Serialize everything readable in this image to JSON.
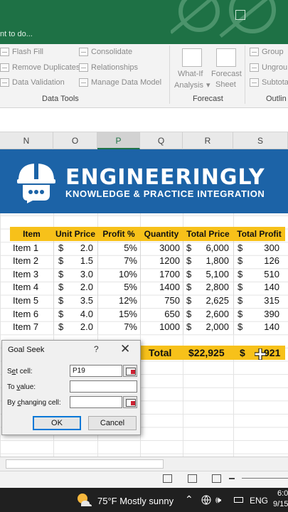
{
  "titlebar": {
    "tell_me": "nt to do..."
  },
  "ribbon": {
    "items": [
      "Flash Fill",
      "Remove Duplicates",
      "Data Validation",
      "Consolidate",
      "Relationships",
      "Manage Data Model",
      "What-If",
      "Analysis",
      "Forecast",
      "Sheet",
      "Group",
      "Ungrou",
      "Subtota"
    ],
    "groups": [
      "Data Tools",
      "Forecast",
      "Outlin"
    ]
  },
  "columns": [
    "N",
    "O",
    "P",
    "Q",
    "R",
    "S"
  ],
  "banner": {
    "title": "ENGINEERINGLY",
    "subtitle": "KNOWLEDGE & PRACTICE INTEGRATION"
  },
  "table": {
    "headers": [
      "Item",
      "Unit Price",
      "Profit %",
      "Quantity",
      "Total Price",
      "Total Profit"
    ],
    "rows": [
      {
        "item": "Item 1",
        "cur": "$",
        "price": "2.0",
        "profit": "5%",
        "qty": "3000",
        "tcur": "$",
        "total": "6,000",
        "pcur": "$",
        "tprofit": "300"
      },
      {
        "item": "Item 2",
        "cur": "$",
        "price": "1.5",
        "profit": "7%",
        "qty": "1200",
        "tcur": "$",
        "total": "1,800",
        "pcur": "$",
        "tprofit": "126"
      },
      {
        "item": "Item 3",
        "cur": "$",
        "price": "3.0",
        "profit": "10%",
        "qty": "1700",
        "tcur": "$",
        "total": "5,100",
        "pcur": "$",
        "tprofit": "510"
      },
      {
        "item": "Item 4",
        "cur": "$",
        "price": "2.0",
        "profit": "5%",
        "qty": "1400",
        "tcur": "$",
        "total": "2,800",
        "pcur": "$",
        "tprofit": "140"
      },
      {
        "item": "Item 5",
        "cur": "$",
        "price": "3.5",
        "profit": "12%",
        "qty": "750",
        "tcur": "$",
        "total": "2,625",
        "pcur": "$",
        "tprofit": "315"
      },
      {
        "item": "Item 6",
        "cur": "$",
        "price": "4.0",
        "profit": "15%",
        "qty": "650",
        "tcur": "$",
        "total": "2,600",
        "pcur": "$",
        "tprofit": "390"
      },
      {
        "item": "Item 7",
        "cur": "$",
        "price": "2.0",
        "profit": "7%",
        "qty": "1000",
        "tcur": "$",
        "total": "2,000",
        "pcur": "$",
        "tprofit": "140"
      }
    ],
    "total_label": "Total",
    "total_price": "$22,925",
    "total_profit_cur": "$",
    "total_profit": "921"
  },
  "dialog": {
    "title": "Goal Seek",
    "help": "?",
    "close": "✕",
    "set_cell_label_pre": "S",
    "set_cell_label_u": "e",
    "set_cell_label_post": "t cell:",
    "set_cell_value": "P19",
    "to_value_label_pre": "To ",
    "to_value_label_u": "v",
    "to_value_label_post": "alue:",
    "to_value_value": "",
    "changing_label_pre": "By ",
    "changing_label_u": "c",
    "changing_label_post": "hanging cell:",
    "changing_value": "",
    "ok": "OK",
    "cancel": "Cancel"
  },
  "taskbar": {
    "weather": "75°F  Mostly sunny",
    "lang": "ENG",
    "time": "6:0",
    "date": "9/15"
  }
}
